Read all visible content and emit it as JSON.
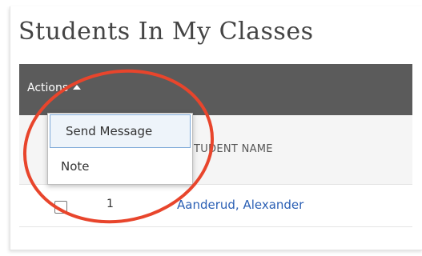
{
  "page": {
    "title": "Students In My Classes"
  },
  "toolbar": {
    "actions_label": "Actions"
  },
  "actions_menu": {
    "items": [
      {
        "label": "Send Message",
        "active": true
      },
      {
        "label": "Note",
        "active": false
      }
    ]
  },
  "table": {
    "columns": [
      "TUDENT NAME"
    ],
    "rows": [
      {
        "number": "1",
        "student_name": "Aanderud, Alexander",
        "checked": false
      }
    ]
  },
  "annotation": {
    "ring_color": "#e8452c"
  },
  "colors": {
    "toolbar_bg": "#5b5b5b",
    "link": "#2a5fb4"
  }
}
